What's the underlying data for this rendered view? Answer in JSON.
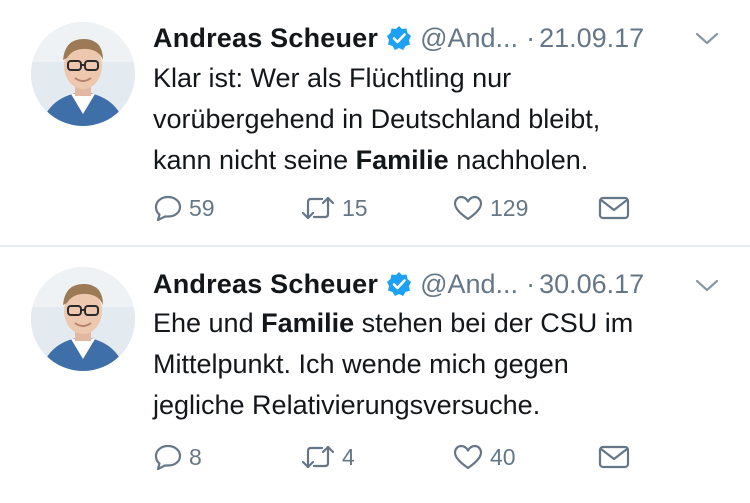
{
  "tweets": [
    {
      "author": "Andreas Scheuer",
      "handle": "@And...",
      "separator": "·",
      "date": "21.09.17",
      "text_parts": {
        "line1": "Klar ist: Wer als Flüchtling nur",
        "line2": "vorübergehend in Deutschland bleibt,",
        "line3_pre": "kann nicht seine ",
        "line3_bold": "Familie",
        "line3_post": " nachholen."
      },
      "replies": "59",
      "retweets": "15",
      "likes": "129"
    },
    {
      "author": "Andreas Scheuer",
      "handle": "@And...",
      "separator": "·",
      "date": "30.06.17",
      "text_parts": {
        "line1_pre": "Ehe und ",
        "line1_bold": "Familie",
        "line1_post": " stehen bei der CSU im",
        "line2": "Mittelpunkt. Ich wende mich gegen",
        "line3": "jegliche Relativierungsversuche."
      },
      "replies": "8",
      "retweets": "4",
      "likes": "40"
    }
  ],
  "colors": {
    "text": "#14171a",
    "secondary": "#657786",
    "verified": "#1da1f2",
    "divider": "#e6ecf0"
  },
  "icons": [
    "avatar",
    "verified-badge-icon",
    "chevron-down-icon",
    "reply-icon",
    "retweet-icon",
    "like-heart-icon",
    "direct-message-envelope-icon"
  ]
}
